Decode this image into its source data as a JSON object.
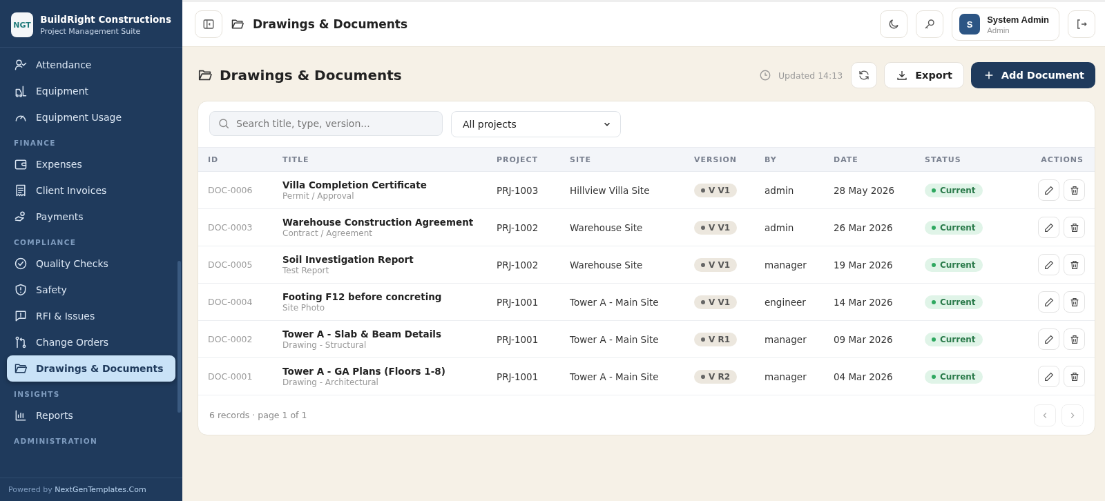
{
  "brand": {
    "logo": "NGT",
    "name": "BuildRight Constructions",
    "subtitle": "Project Management Suite"
  },
  "sidebar": {
    "groups": [
      {
        "items": [
          {
            "label": "Attendance",
            "selected": false
          },
          {
            "label": "Equipment",
            "selected": false
          },
          {
            "label": "Equipment Usage",
            "selected": false
          }
        ]
      },
      {
        "heading": "FINANCE",
        "items": [
          {
            "label": "Expenses",
            "selected": false
          },
          {
            "label": "Client Invoices",
            "selected": false
          },
          {
            "label": "Payments",
            "selected": false
          }
        ]
      },
      {
        "heading": "COMPLIANCE",
        "items": [
          {
            "label": "Quality Checks",
            "selected": false
          },
          {
            "label": "Safety",
            "selected": false
          },
          {
            "label": "RFI & Issues",
            "selected": false
          },
          {
            "label": "Change Orders",
            "selected": false
          },
          {
            "label": "Drawings & Documents",
            "selected": true
          }
        ]
      },
      {
        "heading": "INSIGHTS",
        "items": [
          {
            "label": "Reports",
            "selected": false
          }
        ]
      },
      {
        "heading": "ADMINISTRATION"
      }
    ],
    "footer_prefix": "Powered by",
    "footer_link": "NextGenTemplates.Com"
  },
  "topbar": {
    "title": "Drawings & Documents",
    "user": {
      "initial": "S",
      "name": "System Admin",
      "role": "Admin"
    }
  },
  "page": {
    "title": "Drawings & Documents",
    "updated": "Updated 14:13",
    "export": "Export",
    "add": "Add Document"
  },
  "filters": {
    "search_placeholder": "Search title, type, version...",
    "project": "All projects"
  },
  "table": {
    "columns": [
      "ID",
      "TITLE",
      "PROJECT",
      "SITE",
      "VERSION",
      "BY",
      "DATE",
      "STATUS",
      "ACTIONS"
    ],
    "rows": [
      {
        "id": "DOC-0006",
        "title": "Villa Completion Certificate",
        "type": "Permit / Approval",
        "project": "PRJ-1003",
        "site": "Hillview Villa Site",
        "version": "V V1",
        "by": "admin",
        "date": "28 May 2026",
        "status": "Current"
      },
      {
        "id": "DOC-0003",
        "title": "Warehouse Construction Agreement",
        "type": "Contract / Agreement",
        "project": "PRJ-1002",
        "site": "Warehouse Site",
        "version": "V V1",
        "by": "admin",
        "date": "26 Mar 2026",
        "status": "Current"
      },
      {
        "id": "DOC-0005",
        "title": "Soil Investigation Report",
        "type": "Test Report",
        "project": "PRJ-1002",
        "site": "Warehouse Site",
        "version": "V V1",
        "by": "manager",
        "date": "19 Mar 2026",
        "status": "Current"
      },
      {
        "id": "DOC-0004",
        "title": "Footing F12 before concreting",
        "type": "Site Photo",
        "project": "PRJ-1001",
        "site": "Tower A - Main Site",
        "version": "V V1",
        "by": "engineer",
        "date": "14 Mar 2026",
        "status": "Current"
      },
      {
        "id": "DOC-0002",
        "title": "Tower A - Slab & Beam Details",
        "type": "Drawing - Structural",
        "project": "PRJ-1001",
        "site": "Tower A - Main Site",
        "version": "V R1",
        "by": "manager",
        "date": "09 Mar 2026",
        "status": "Current"
      },
      {
        "id": "DOC-0001",
        "title": "Tower A - GA Plans (Floors 1-8)",
        "type": "Drawing - Architectural",
        "project": "PRJ-1001",
        "site": "Tower A - Main Site",
        "version": "V R2",
        "by": "manager",
        "date": "04 Mar 2026",
        "status": "Current"
      }
    ],
    "footer": "6 records · page 1 of 1"
  }
}
